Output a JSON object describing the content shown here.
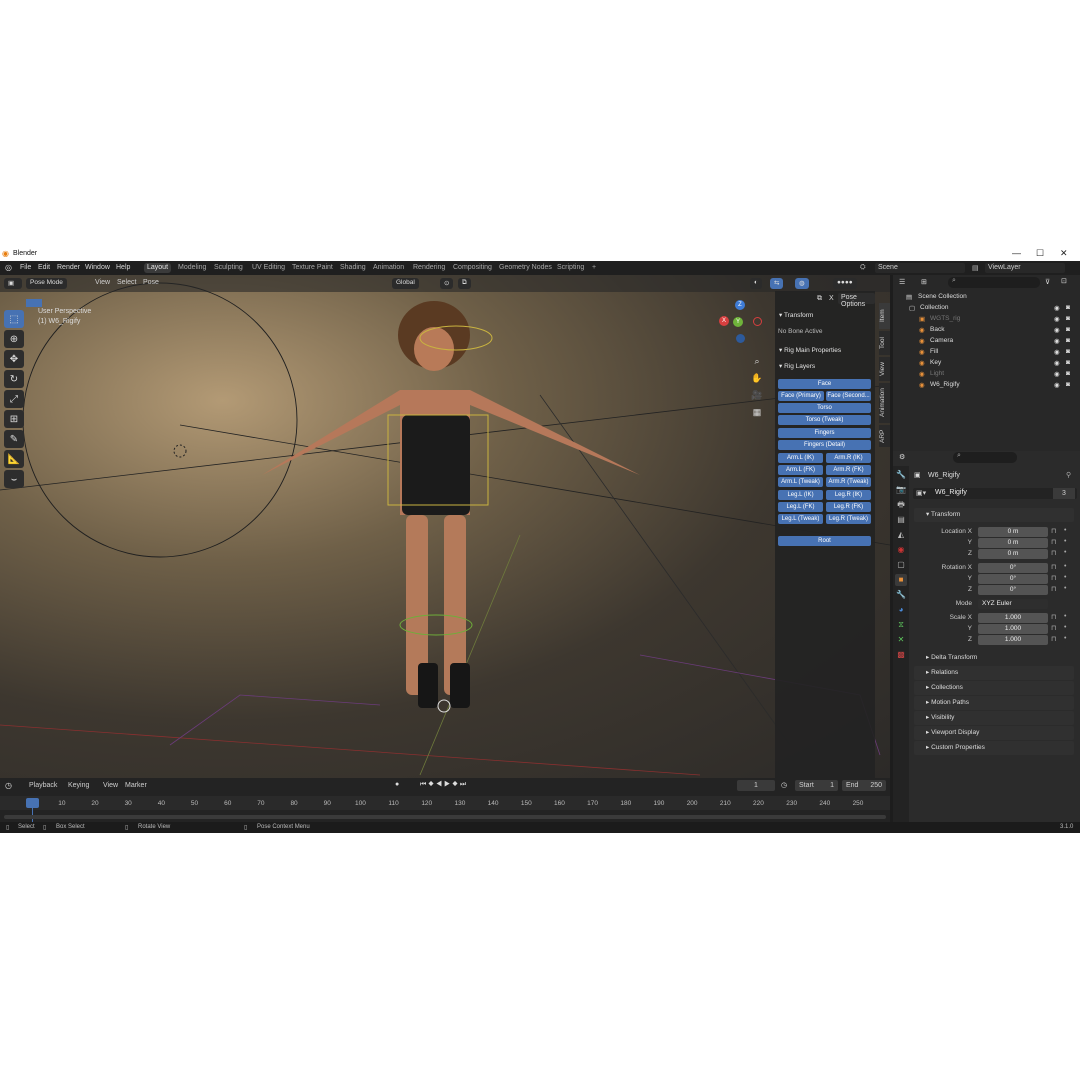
{
  "window": {
    "title": "Blender",
    "controls": [
      "—",
      "☐",
      "✕"
    ]
  },
  "menubar": {
    "menus": [
      "File",
      "Edit",
      "Render",
      "Window",
      "Help"
    ],
    "workspaces": [
      "Layout",
      "Modeling",
      "Sculpting",
      "UV Editing",
      "Texture Paint",
      "Shading",
      "Animation",
      "Rendering",
      "Compositing",
      "Geometry Nodes",
      "Scripting"
    ],
    "active_workspace": "Layout",
    "add": "+",
    "scene": "Scene",
    "view_layer": "ViewLayer"
  },
  "viewport_header": {
    "mode": "Pose Mode",
    "menus": [
      "View",
      "Select",
      "Pose"
    ],
    "orientation": "Global"
  },
  "viewport": {
    "perspective": "User Perspective",
    "object": "(1) W6_Rigify"
  },
  "gizmo": {
    "x": "X",
    "y": "Y",
    "z": "Z"
  },
  "npanel": {
    "pose_options": "Pose Options",
    "transform": "Transform",
    "no_bone": "No Bone Active",
    "rig_main": "Rig Main Properties",
    "rig_layers": "Rig Layers",
    "buttons": {
      "face": "Face",
      "face_primary": "Face (Primary)",
      "face_secondary": "Face (Second...",
      "torso": "Torso",
      "torso_tweak": "Torso (Tweak)",
      "fingers": "Fingers",
      "fingers_detail": "Fingers (Detail)",
      "arm_l_ik": "Arm.L (IK)",
      "arm_r_ik": "Arm.R (IK)",
      "arm_l_fk": "Arm.L (FK)",
      "arm_r_fk": "Arm.R (FK)",
      "arm_l_tweak": "Arm.L (Tweak)",
      "arm_r_tweak": "Arm.R (Tweak)",
      "leg_l_ik": "Leg.L (IK)",
      "leg_r_ik": "Leg.R (IK)",
      "leg_l_fk": "Leg.L (FK)",
      "leg_r_fk": "Leg.R (FK)",
      "leg_l_tweak": "Leg.L (Tweak)",
      "leg_r_tweak": "Leg.R (Tweak)",
      "root": "Root"
    },
    "tabs": [
      "Item",
      "Tool",
      "View",
      "Animation",
      "ARP"
    ]
  },
  "timeline": {
    "menus": [
      "Playback",
      "Keying",
      "View",
      "Marker"
    ],
    "current_frame": "1",
    "start_label": "Start",
    "start": "1",
    "end_label": "End",
    "end": "250",
    "ticks": [
      "1",
      "10",
      "20",
      "30",
      "40",
      "50",
      "60",
      "70",
      "80",
      "90",
      "100",
      "110",
      "120",
      "130",
      "140",
      "150",
      "160",
      "170",
      "180",
      "190",
      "200",
      "210",
      "220",
      "230",
      "240",
      "250"
    ]
  },
  "statusbar": {
    "select": "Select",
    "box_select": "Box Select",
    "rotate": "Rotate View",
    "context": "Pose Context Menu",
    "version": "3.1.0"
  },
  "outliner": {
    "scene_collection": "Scene Collection",
    "items": [
      {
        "name": "Collection",
        "indent": 1
      },
      {
        "name": "WGTS_rig",
        "indent": 2
      },
      {
        "name": "Back",
        "indent": 2
      },
      {
        "name": "Camera",
        "indent": 2
      },
      {
        "name": "Fill",
        "indent": 2
      },
      {
        "name": "Key",
        "indent": 2
      },
      {
        "name": "Light",
        "indent": 2
      },
      {
        "name": "W6_Rigify",
        "indent": 2
      }
    ]
  },
  "properties": {
    "object_name": "W6_Rigify",
    "data_name": "W6_Rigify",
    "users": "3",
    "transform": "Transform",
    "location_label": "Location X",
    "y": "Y",
    "z": "Z",
    "loc": [
      "0 m",
      "0 m",
      "0 m"
    ],
    "rotation_label": "Rotation X",
    "rot": [
      "0°",
      "0°",
      "0°"
    ],
    "mode_label": "Mode",
    "mode": "XYZ Euler",
    "scale_label": "Scale X",
    "scale": [
      "1.000",
      "1.000",
      "1.000"
    ],
    "delta": "Delta Transform",
    "panels": [
      "Relations",
      "Collections",
      "Motion Paths",
      "Visibility",
      "Viewport Display",
      "Custom Properties"
    ]
  },
  "colors": {
    "accent": "#4772b3",
    "bg": "#1d1d1d",
    "panel": "#2b2b2b"
  }
}
